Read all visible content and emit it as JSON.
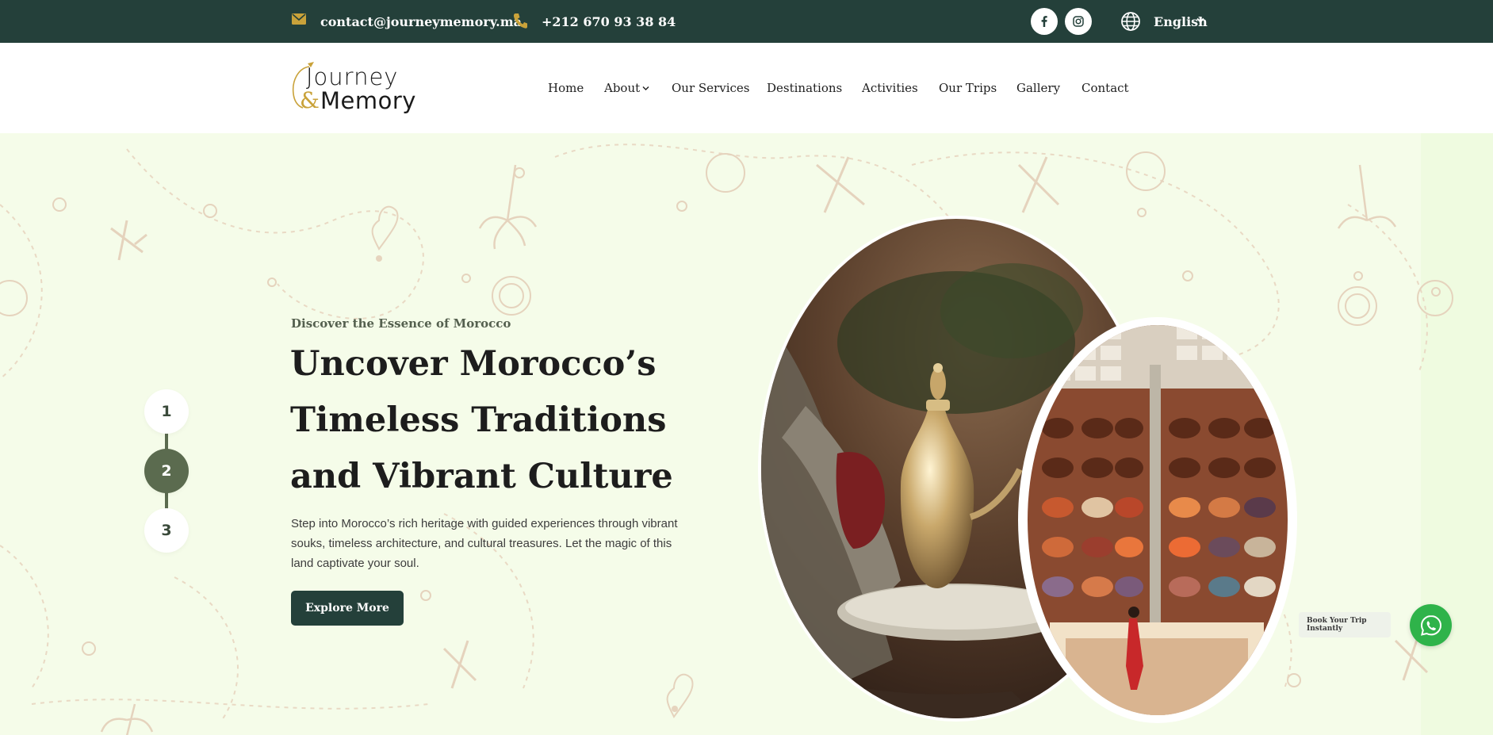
{
  "topbar": {
    "email": "contact@journeymemory.ma",
    "phone": "+212 670 93 38 84",
    "language": "English",
    "icons": [
      "envelope-icon",
      "phone-icon",
      "facebook-icon",
      "instagram-icon",
      "globe-icon",
      "chevron-down-icon"
    ]
  },
  "header": {
    "logo": {
      "line1": "Journey",
      "amp": "&",
      "line2": "Memory"
    },
    "nav": {
      "home": "Home",
      "about": "About",
      "services": "Our Services",
      "destinations": "Destinations",
      "activities": "Activities",
      "trips": "Our Trips",
      "gallery": "Gallery",
      "contact": "Contact"
    }
  },
  "hero": {
    "eyebrow": "Discover the Essence of Morocco",
    "headline": "Uncover Morocco’s Timeless Traditions and Vibrant Culture",
    "description": "Step into Morocco’s rich heritage with guided experiences through vibrant souks, timeless architecture, and cultural treasures. Let the magic of this land captivate your soul.",
    "cta": "Explore More",
    "steps": [
      "1",
      "2",
      "3"
    ],
    "active_step": "2"
  },
  "widgets": {
    "book_label": "Book Your Trip Instantly",
    "whatsapp_icon": "whatsapp-icon"
  },
  "colors": {
    "topbar": "#24403a",
    "accent_gold": "#c9a23a",
    "hero_bg": "#f5fce9",
    "step_active": "#5b6b4f",
    "button": "#24403a",
    "whatsapp": "#2fb34a"
  }
}
